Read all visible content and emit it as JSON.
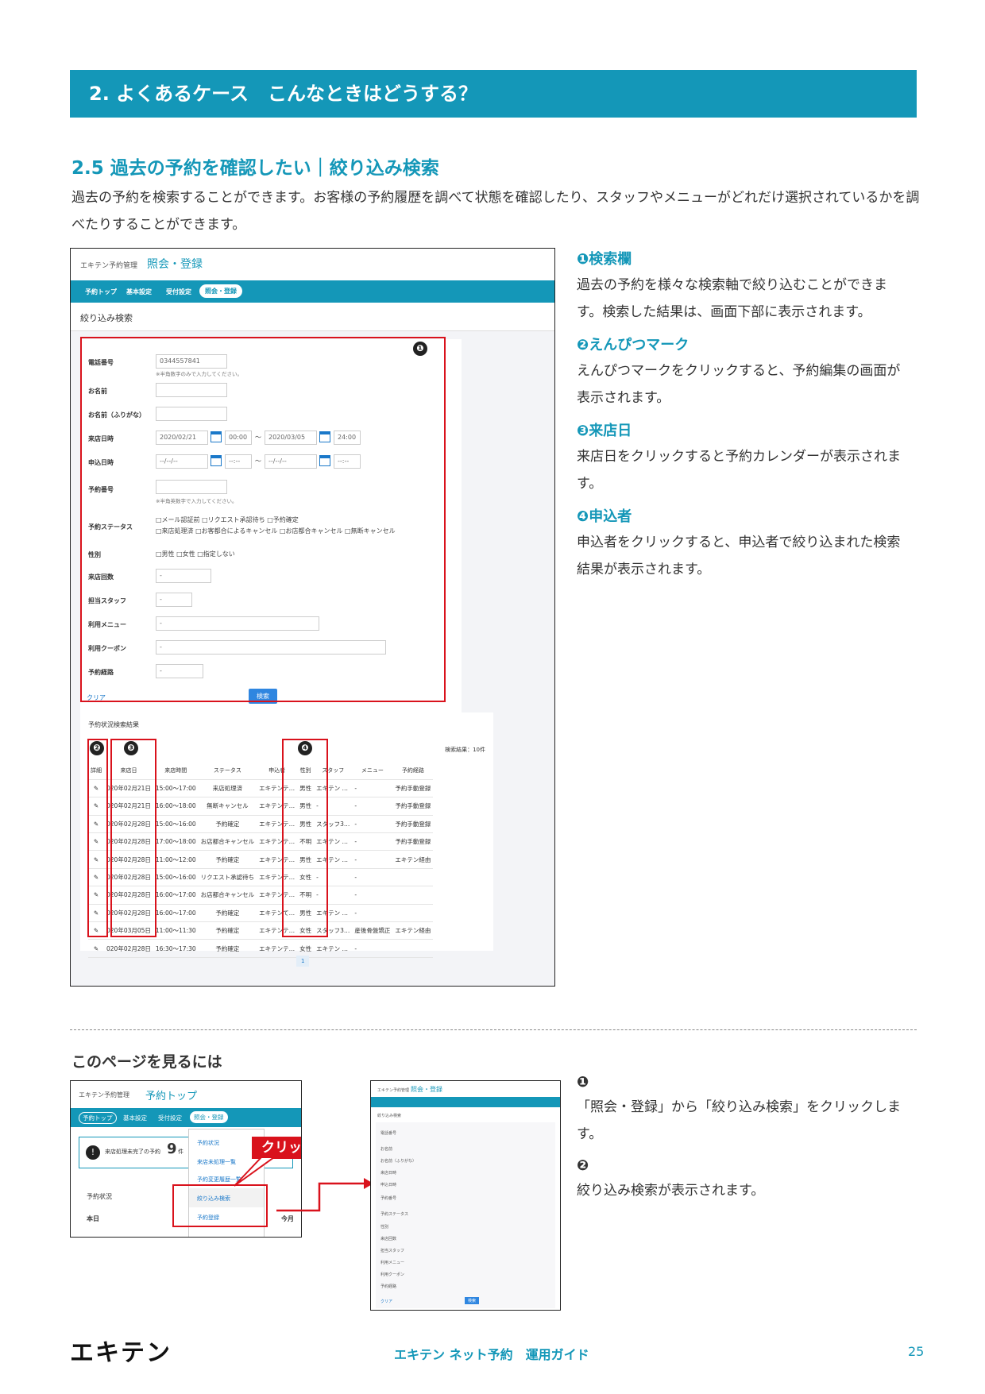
{
  "chapter_title": "2. よくあるケース　こんなときはどうする？",
  "section_title": "2.5 過去の予約を確認したい｜絞り込み検索",
  "intro": "過去の予約を検索することができます。お客様の予約履歴を調べて状態を確認したり、スタッフやメニューがどれだけ選択されているかを調べたりすることができます。",
  "screenshot": {
    "app_name": "エキテン予約管理",
    "page_name": "照会・登録",
    "nav": [
      "予約トップ",
      "基本設定",
      "受付設定",
      "照会・登録"
    ],
    "sub_title": "絞り込み検索",
    "form": {
      "phone_label": "電話番号",
      "phone_placeholder": "0344557841",
      "phone_note": "※半角数字のみで入力してください。",
      "name_label": "お名前",
      "kana_label": "お名前（ふりがな）",
      "visit_label": "来店日時",
      "visit_from": "2020/02/21",
      "visit_from_time": "00:00",
      "visit_to": "2020/03/05",
      "visit_to_time": "24:00",
      "tilde": "〜",
      "apply_label": "申込日時",
      "apply_blank": "--/--/--",
      "apply_time_blank": "--:--",
      "number_label": "予約番号",
      "number_note": "※半角英数字で入力してください。",
      "status_label": "予約ステータス",
      "status_options_1": "□メール認証前 □リクエスト承認待ち □予約確定",
      "status_options_2": "□来店処理済 □お客都合によるキャンセル □お店都合キャンセル □無断キャンセル",
      "gender_label": "性別",
      "gender_options": "□男性 □女性 □指定しない",
      "visits_label": "来店回数",
      "staff_label": "担当スタッフ",
      "menu_label": "利用メニュー",
      "coupon_label": "利用クーポン",
      "route_label": "予約経路",
      "select_blank": "-",
      "clear": "クリア",
      "search": "検索"
    },
    "results": {
      "title": "予約状況検索結果",
      "count": "検索結果：10件",
      "headers": [
        "詳細",
        "来店日",
        "来店時間",
        "ステータス",
        "申込者",
        "性別",
        "スタッフ",
        "メニュー",
        "予約経路"
      ],
      "rows": [
        [
          "020年02月21日",
          "15:00〜17:00",
          "来店処理済",
          "エキテンテ…",
          "男性",
          "エキテン …",
          "-",
          "予約手動登録"
        ],
        [
          "020年02月21日",
          "16:00〜18:00",
          "無断キャンセル",
          "エキテンテ…",
          "男性",
          "-",
          "-",
          "予約手動登録"
        ],
        [
          "020年02月28日",
          "15:00〜16:00",
          "予約確定",
          "エキテンテ…",
          "男性",
          "スタッフ3…",
          "-",
          "予約手動登録"
        ],
        [
          "020年02月28日",
          "17:00〜18:00",
          "お店都合キャンセル",
          "エキテンテ…",
          "不明",
          "エキテン …",
          "-",
          "予約手動登録"
        ],
        [
          "020年02月28日",
          "11:00〜12:00",
          "予約確定",
          "エキテンテ…",
          "男性",
          "エキテン …",
          "-",
          "エキテン経由"
        ],
        [
          "020年02月28日",
          "15:00〜16:00",
          "リクエスト承認待ち",
          "エキテンテ…",
          "女性",
          "-",
          "-",
          ""
        ],
        [
          "020年02月28日",
          "16:00〜17:00",
          "お店都合キャンセル",
          "エキテンテ…",
          "不明",
          "-",
          "-",
          ""
        ],
        [
          "020年02月28日",
          "16:00〜17:00",
          "予約確定",
          "エキテンて…",
          "男性",
          "エキテン …",
          "-",
          ""
        ],
        [
          "020年03月05日",
          "11:00〜11:30",
          "予約確定",
          "エキテンテ…",
          "女性",
          "スタッフ3…",
          "産後骨盤矯正",
          "エキテン経由"
        ],
        [
          "020年02月28日",
          "16:30〜17:30",
          "予約確定",
          "エキテンテ…",
          "女性",
          "エキテン …",
          "-",
          ""
        ]
      ],
      "pager": "1"
    },
    "markers": [
      "❶",
      "❷",
      "❸",
      "❹"
    ]
  },
  "callouts": [
    {
      "title": "❶検索欄",
      "body": "過去の予約を様々な検索軸で絞り込むことができます。検索した結果は、画面下部に表示されます。"
    },
    {
      "title": "❷えんぴつマーク",
      "body": "えんぴつマークをクリックすると、予約編集の画面が表示されます。"
    },
    {
      "title": "❸来店日",
      "body": "来店日をクリックすると予約カレンダーが表示されます。"
    },
    {
      "title": "❹申込者",
      "body": "申込者をクリックすると、申込者で絞り込まれた検索結果が表示されます。"
    }
  ],
  "how_to": {
    "title": "このページを見るには",
    "nav_shot": {
      "app_name": "エキテン予約管理",
      "page_name": "予約トップ",
      "nav": [
        "予約トップ",
        "基本設定",
        "受付設定",
        "照会・登録"
      ],
      "menu": [
        "予約状況",
        "来店未処理一覧",
        "予約変更履歴一覧",
        "絞り込み検索",
        "予約登録"
      ],
      "notice": "来店処理未完了の予約",
      "notice_count": "9",
      "notice_unit": "件",
      "status": "予約状況",
      "today": "本日",
      "month": "今月",
      "click": "クリック"
    },
    "steps": [
      {
        "num": "❶",
        "text": "「照会・登録」から「絞り込み検索」をクリックします。"
      },
      {
        "num": "❷",
        "text": "絞り込み検索が表示されます。"
      }
    ]
  },
  "footer": {
    "logo": "エキテン",
    "title": "エキテン ネット予約　運用ガイド",
    "page": "25"
  },
  "colors": {
    "accent": "#1497b8",
    "highlight": "#d9121c"
  }
}
